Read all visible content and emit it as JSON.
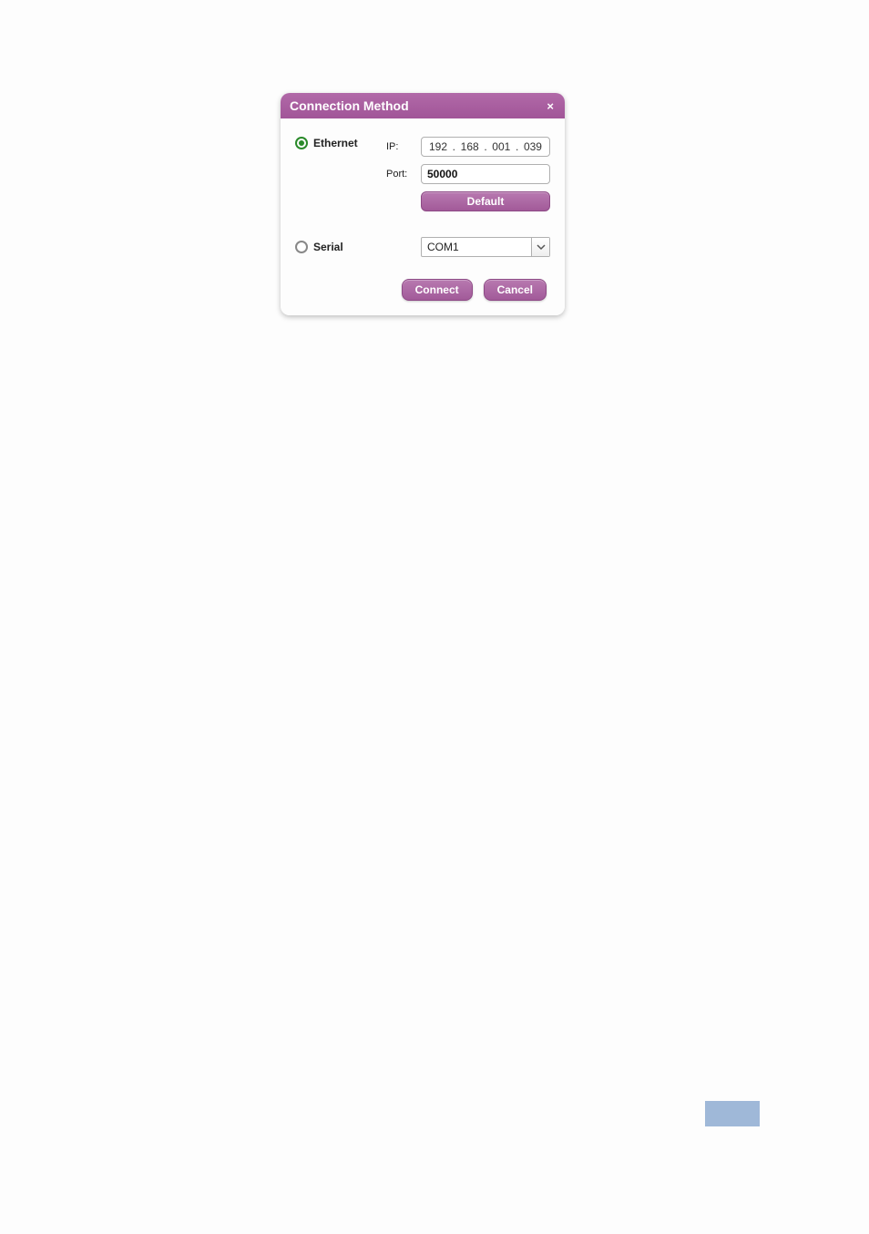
{
  "dialog": {
    "title": "Connection Method",
    "close_icon": "×"
  },
  "ethernet": {
    "radio_label": "Ethernet",
    "selected": true,
    "ip_label": "IP:",
    "ip": {
      "a": "192",
      "b": "168",
      "c": "001",
      "d": "039"
    },
    "port_label": "Port:",
    "port_value": "50000",
    "default_button": "Default"
  },
  "serial": {
    "radio_label": "Serial",
    "selected": false,
    "com_value": "COM1"
  },
  "buttons": {
    "connect": "Connect",
    "cancel": "Cancel"
  }
}
